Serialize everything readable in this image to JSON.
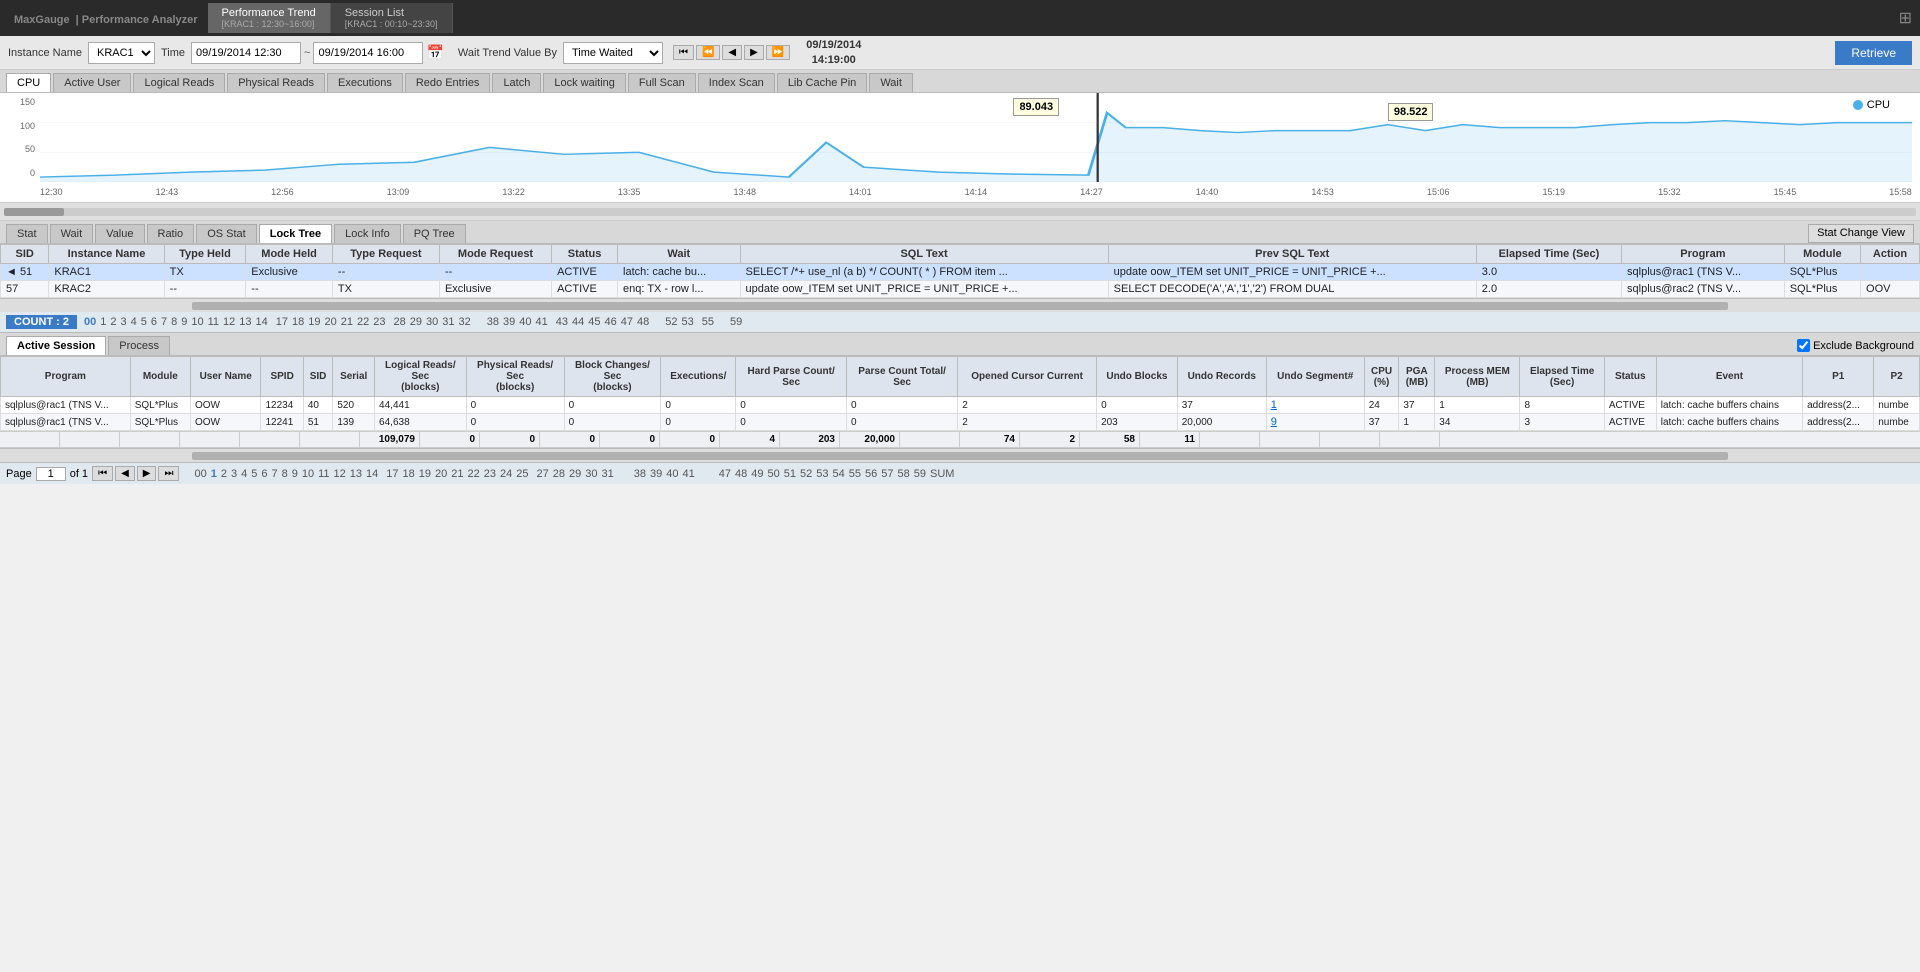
{
  "header": {
    "logo": "MaxGauge",
    "logo_sub": "| Performance Analyzer",
    "tab1_label": "Performance Trend",
    "tab1_sub": "[KRAC1 : 12:30~16:00]",
    "tab2_label": "Session List",
    "tab2_sub": "[KRAC1 : 00:10~23:30]",
    "grid_icon": "⊞"
  },
  "toolbar": {
    "instance_label": "Instance Name",
    "instance_value": "KRAC1",
    "time_label": "Time",
    "time_from": "09/19/2014 12:30",
    "time_to": "09/19/2014 16:00",
    "wait_trend_label": "Wait Trend Value By",
    "wait_trend_value": "Time Waited",
    "date_line1": "09/19/2014",
    "date_line2": "14:19:00",
    "retrieve_label": "Retrieve"
  },
  "chart_tabs": [
    "CPU",
    "Active User",
    "Logical Reads",
    "Physical Reads",
    "Executions",
    "Redo Entries",
    "Latch",
    "Lock waiting",
    "Full Scan",
    "Index Scan",
    "Lib Cache Pin",
    "Wait"
  ],
  "chart": {
    "y_labels": [
      "150",
      "100",
      "50",
      "0"
    ],
    "x_labels": [
      "12:30",
      "12:43",
      "12:56",
      "13:09",
      "13:22",
      "13:35",
      "13:48",
      "14:01",
      "14:14",
      "14:27",
      "14:40",
      "14:53",
      "15:06",
      "15:19",
      "15:32",
      "15:45",
      "15:58"
    ],
    "legend": "CPU",
    "tooltip1_value": "89.043",
    "tooltip1_x_pct": 48,
    "tooltip2_value": "98.522",
    "tooltip2_x_pct": 74
  },
  "sub_tabs": [
    "Stat",
    "Wait",
    "Value",
    "Ratio",
    "OS Stat",
    "Lock Tree",
    "Lock Info",
    "PQ Tree"
  ],
  "active_sub_tab": "Lock Tree",
  "stat_change_btn": "Stat Change View",
  "lock_table": {
    "columns": [
      "SID",
      "Instance Name",
      "Type Held",
      "Mode Held",
      "Type Request",
      "Mode Request",
      "Status",
      "Wait",
      "SQL Text",
      "Prev SQL Text",
      "Elapsed Time (Sec)",
      "Program",
      "Module",
      "Action"
    ],
    "rows": [
      {
        "sid": "51",
        "instance": "KRAC1",
        "type_held": "TX",
        "mode_held": "Exclusive",
        "type_req": "--",
        "mode_req": "--",
        "status": "ACTIVE",
        "wait": "latch: cache bu...",
        "sql_text": "SELECT /*+ use_nl (a b) */ COUNT( * ) FROM item ...",
        "prev_sql": "update oow_ITEM set UNIT_PRICE = UNIT_PRICE +...",
        "elapsed": "3.0",
        "program": "sqlplus@rac1 (TNS V...",
        "module": "SQL*Plus",
        "action": "",
        "indent": true
      },
      {
        "sid": "57",
        "instance": "KRAC2",
        "type_held": "--",
        "mode_held": "--",
        "type_req": "TX",
        "mode_req": "Exclusive",
        "status": "ACTIVE",
        "wait": "enq: TX - row l...",
        "sql_text": "update oow_ITEM set UNIT_PRICE = UNIT_PRICE +...",
        "prev_sql": "SELECT DECODE('A','A','1','2') FROM DUAL",
        "elapsed": "2.0",
        "program": "sqlplus@rac2 (TNS V...",
        "module": "SQL*Plus",
        "action": "OOV",
        "indent": false
      }
    ]
  },
  "count_bar": {
    "label": "COUNT : 2",
    "page_nums_top": [
      "00",
      "1",
      "2",
      "3",
      "4",
      "5",
      "6",
      "7",
      "8",
      "9",
      "10",
      "11",
      "12",
      "13",
      "14",
      "",
      "17",
      "18",
      "19",
      "20",
      "21",
      "22",
      "23",
      "",
      "28",
      "29",
      "30",
      "31",
      "32",
      "",
      "",
      "",
      "38",
      "39",
      "40",
      "41",
      "",
      "43",
      "44",
      "45",
      "46",
      "47",
      "48",
      "",
      "",
      "",
      "52",
      "53",
      "",
      "55",
      "",
      "",
      "",
      "59"
    ]
  },
  "session_tabs": [
    "Active Session",
    "Process"
  ],
  "exclude_bg_label": "Exclude Background",
  "active_session_table": {
    "columns": [
      "Program",
      "Module",
      "User Name",
      "SPID",
      "SID",
      "Serial",
      "Logical Reads/Sec (blocks)",
      "Physical Reads/Sec (blocks)",
      "Block Changes/Sec (blocks)",
      "Executions/",
      "Hard Parse Count/Sec",
      "Parse Count Total/Sec",
      "Opened Cursor Current",
      "Undo Blocks",
      "Undo Records",
      "Undo Segment#",
      "CPU (%)",
      "PGA (MB)",
      "Process MEM (MB)",
      "Elapsed Time (Sec)",
      "Status",
      "Event",
      "P1",
      "P2"
    ],
    "rows": [
      {
        "program": "sqlplus@rac1 (TNS V...",
        "module": "SQL*Plus",
        "username": "OOW",
        "spid": "12234",
        "sid": "40",
        "serial": "520",
        "logical_reads": "44,441",
        "physical_reads": "0",
        "block_changes": "0",
        "executions": "0",
        "hard_parse": "0",
        "parse_total": "0",
        "opened_cursor": "2",
        "undo_blocks": "0",
        "undo_records": "37",
        "undo_seg": "1",
        "cpu": "24",
        "pga": "37",
        "process_mem": "1",
        "elapsed": "8",
        "status": "ACTIVE",
        "event": "latch: cache buffers chains",
        "p1": "address(2...",
        "p2": "numbe"
      },
      {
        "program": "sqlplus@rac1 (TNS V...",
        "module": "SQL*Plus",
        "username": "OOW",
        "spid": "12241",
        "sid": "51",
        "serial": "139",
        "logical_reads": "64,638",
        "physical_reads": "0",
        "block_changes": "0",
        "executions": "0",
        "hard_parse": "0",
        "parse_total": "0",
        "opened_cursor": "2",
        "undo_blocks": "203",
        "undo_records": "20,000",
        "undo_seg": "9",
        "cpu": "37",
        "pga": "1",
        "process_mem": "34",
        "elapsed": "3",
        "status": "ACTIVE",
        "event": "latch: cache buffers chains",
        "p1": "address(2...",
        "p2": "numbe"
      }
    ],
    "totals": {
      "logical_reads": "109,079",
      "physical_reads": "0",
      "block_changes": "0",
      "executions": "0",
      "hard_parse": "0",
      "parse_total": "0",
      "opened_cursor": "4",
      "undo_blocks": "203",
      "undo_records": "20,000",
      "undo_seg": "",
      "cpu": "74",
      "pga": "2",
      "process_mem": "58",
      "elapsed": "11"
    }
  },
  "bottom_page": {
    "page_label": "Page",
    "page_current": "1",
    "page_of": "of 1",
    "page_nums": [
      "00",
      "1",
      "2",
      "3",
      "4",
      "5",
      "6",
      "7",
      "8",
      "9",
      "10",
      "11",
      "12",
      "13",
      "14",
      "",
      "17",
      "18",
      "19",
      "20",
      "21",
      "22",
      "23",
      "24",
      "25",
      "",
      "27",
      "28",
      "29",
      "30",
      "31",
      "",
      "",
      "",
      "",
      "38",
      "39",
      "40",
      "41",
      "",
      "",
      "",
      "",
      "",
      "47",
      "48",
      "49",
      "50",
      "51",
      "52",
      "53",
      "54",
      "55",
      "56",
      "57",
      "58",
      "59",
      "SUM"
    ],
    "sum_label": "SUM"
  }
}
